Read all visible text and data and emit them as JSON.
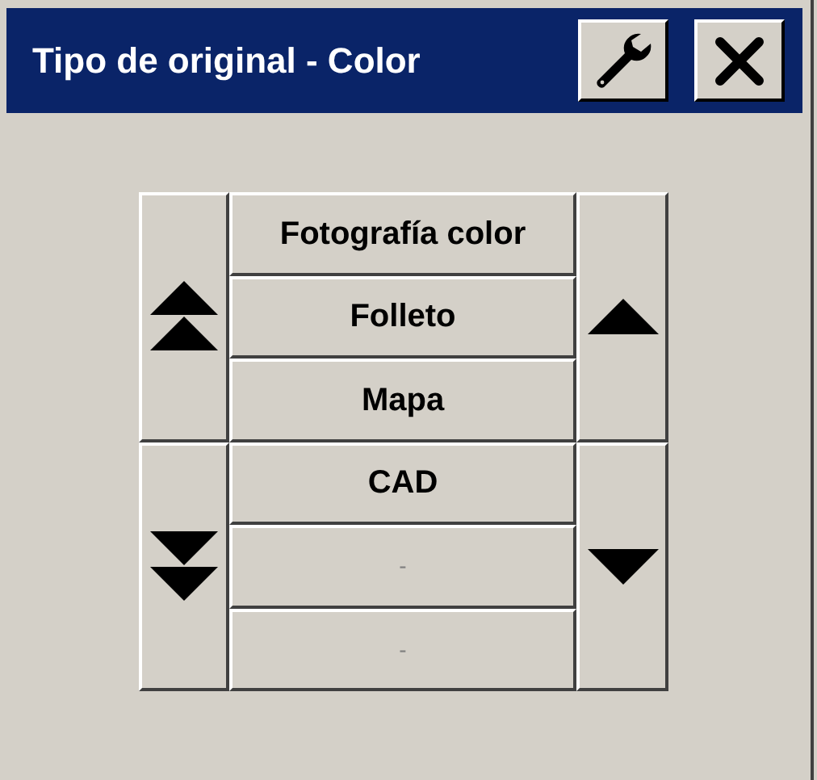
{
  "window": {
    "title": "Tipo de original - Color"
  },
  "options": [
    {
      "label": "Fotografía color",
      "disabled": false
    },
    {
      "label": "Folleto",
      "disabled": false
    },
    {
      "label": "Mapa",
      "disabled": false
    },
    {
      "label": "CAD",
      "disabled": false
    },
    {
      "label": "-",
      "disabled": true
    },
    {
      "label": "-",
      "disabled": true
    }
  ]
}
